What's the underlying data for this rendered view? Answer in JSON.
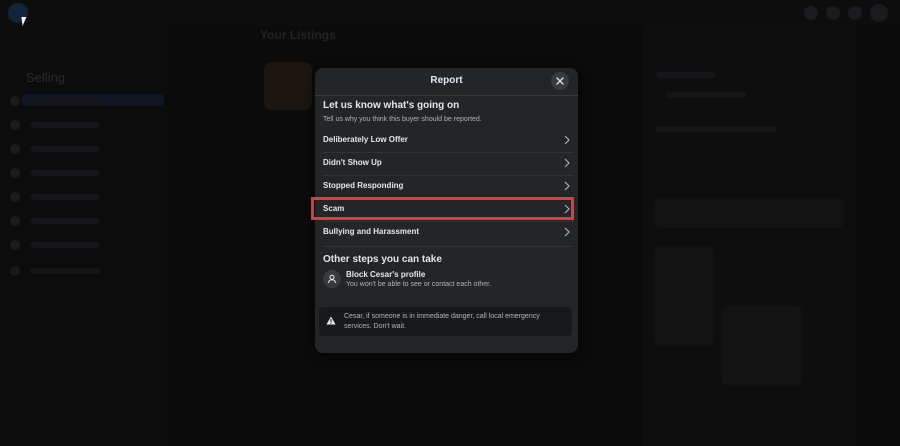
{
  "background_page": {
    "sidebar_title": "Selling",
    "page_title": "Your Listings"
  },
  "modal": {
    "title": "Report",
    "close_icon": "close-icon",
    "heading": "Let us know what's going on",
    "subtext": "Tell us why you think this buyer should be reported.",
    "options": [
      {
        "label": "Deliberately Low Offer"
      },
      {
        "label": "Didn't Show Up"
      },
      {
        "label": "Stopped Responding"
      },
      {
        "label": "Scam",
        "highlighted": true
      },
      {
        "label": "Bullying and Harassment"
      }
    ],
    "other_heading": "Other steps you can take",
    "block": {
      "title": "Block Cesar's profile",
      "description": "You won't be able to see or contact each other.",
      "icon": "block-user-icon"
    },
    "warning": {
      "icon": "warning-icon",
      "text": "Cesar, if someone is in immediate danger, call local emergency services. Don't wait."
    }
  },
  "colors": {
    "modal_bg": "#242526",
    "highlight": "#e13a3a",
    "text_primary": "#e4e6eb",
    "text_secondary": "#b0b3b8"
  }
}
